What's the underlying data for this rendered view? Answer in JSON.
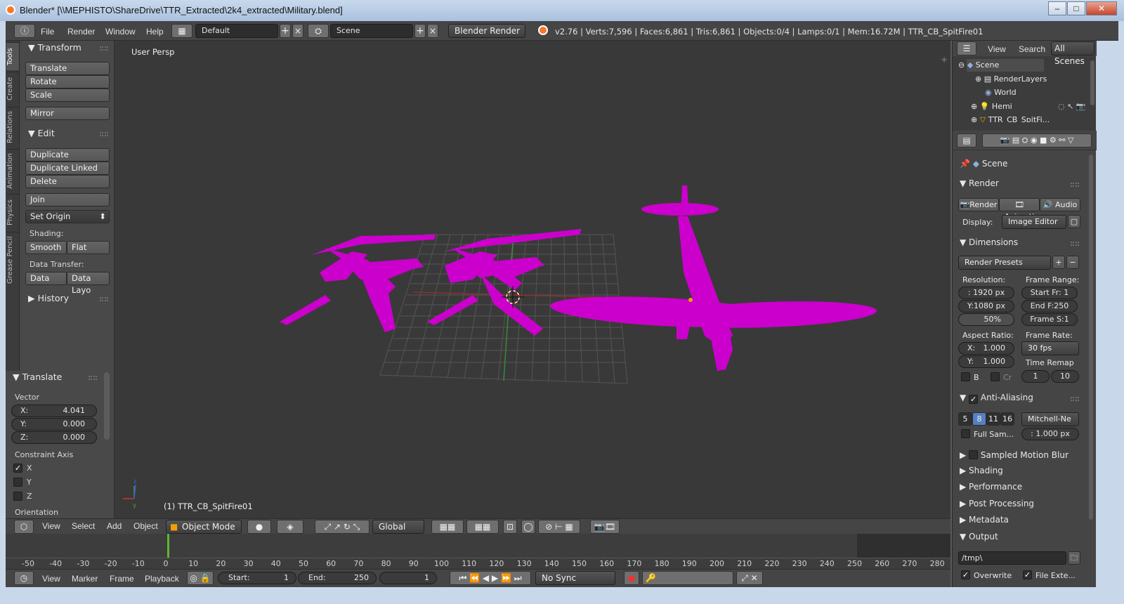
{
  "window": {
    "title": "Blender* [\\\\MEPHISTO\\ShareDrive\\TTR_Extracted\\2k4_extracted\\Military.blend]",
    "minimize": "–",
    "maximize": "□",
    "close": "✕"
  },
  "topbar": {
    "menus": [
      "File",
      "Render",
      "Window",
      "Help"
    ],
    "layout": "Default",
    "scene": "Scene",
    "engine": "Blender Render",
    "stats": "v2.76 | Verts:7,596 | Faces:6,861 | Tris:6,861 | Objects:0/4 | Lamps:0/1 | Mem:16.72M | TTR_CB_SpitFire01"
  },
  "toolshelf": {
    "tabs": [
      "Tools",
      "Create",
      "Relations",
      "Animation",
      "Physics",
      "Grease Pencil"
    ],
    "transform_title": "Transform",
    "translate": "Translate",
    "rotate": "Rotate",
    "scale": "Scale",
    "mirror": "Mirror",
    "edit_title": "Edit",
    "duplicate": "Duplicate",
    "duplicate_linked": "Duplicate Linked",
    "delete": "Delete",
    "join": "Join",
    "set_origin": "Set Origin",
    "shading_label": "Shading:",
    "smooth": "Smooth",
    "flat": "Flat",
    "data_transfer_label": "Data Transfer:",
    "data": "Data",
    "data_layo": "Data Layo",
    "history_title": "History"
  },
  "operator": {
    "title": "Translate",
    "vector_label": "Vector",
    "x_label": "X:",
    "x": "4.041",
    "y_label": "Y:",
    "y": "0.000",
    "z_label": "Z:",
    "z": "0.000",
    "constraint_label": "Constraint Axis",
    "cx": "X",
    "cy": "Y",
    "cz": "Z",
    "orientation_label": "Orientation"
  },
  "viewport": {
    "label": "User Persp",
    "object_label": "(1) TTR_CB_SpitFire01",
    "accent": "#cc00cc"
  },
  "viewheader": {
    "menus": [
      "View",
      "Select",
      "Add",
      "Object"
    ],
    "mode": "Object Mode",
    "orientation": "Global"
  },
  "timeline": {
    "ticks": [
      "-50",
      "-40",
      "-30",
      "-20",
      "-10",
      "0",
      "10",
      "20",
      "30",
      "40",
      "50",
      "60",
      "70",
      "80",
      "90",
      "100",
      "110",
      "120",
      "130",
      "140",
      "150",
      "160",
      "170",
      "180",
      "190",
      "200",
      "210",
      "220",
      "230",
      "240",
      "250",
      "260",
      "270",
      "280"
    ],
    "current_frame_marker": "0"
  },
  "tlbar": {
    "menus": [
      "View",
      "Marker",
      "Frame",
      "Playback"
    ],
    "start_label": "Start:",
    "start": "1",
    "end_label": "End:",
    "end": "250",
    "current": "1",
    "sync": "No Sync"
  },
  "outliner": {
    "view": "View",
    "search": "Search",
    "all_scenes": "All Scenes",
    "items": [
      "Scene",
      "RenderLayers",
      "World",
      "Hemi",
      "TTR_CB_SpitFi..."
    ]
  },
  "props": {
    "context": "Scene",
    "render_title": "Render",
    "render_btn": "Render",
    "anim_btn": "Animati",
    "audio_btn": "Audio",
    "display_label": "Display:",
    "display": "Image Editor",
    "dimensions_title": "Dimensions",
    "render_presets": "Render Presets",
    "resolution_label": "Resolution:",
    "res_x": "1920 px",
    "res_x_label": ":",
    "res_y": "Y:1080 px",
    "res_pct": "50%",
    "frame_range_label": "Frame Range:",
    "start_fr": "Start Fr:  1",
    "end_fr": "End F:250",
    "frame_s": "Frame S:1",
    "aspect_label": "Aspect Ratio:",
    "asp_x": "1.000",
    "asp_x_label": "X:",
    "asp_y": "1.000",
    "asp_y_label": "Y:",
    "frame_rate_label": "Frame Rate:",
    "fps": "30 fps",
    "time_remap": "Time Remap",
    "b": "B",
    "cr": "Cr",
    "remap_old": "1",
    "remap_new": "10",
    "aa_title": "Anti-Aliasing",
    "aa_samples": [
      "5",
      "8",
      "11",
      "16"
    ],
    "aa_filter": "Mitchell-Ne",
    "full_sample": "Full Sam...",
    "filter_size": ": 1.000 px",
    "motion_blur": "Sampled Motion Blur",
    "shading": "Shading",
    "performance": "Performance",
    "post_processing": "Post Processing",
    "metadata": "Metadata",
    "output": "Output",
    "output_path": "/tmp\\",
    "overwrite": "Overwrite",
    "file_ext": "File Exte..."
  }
}
